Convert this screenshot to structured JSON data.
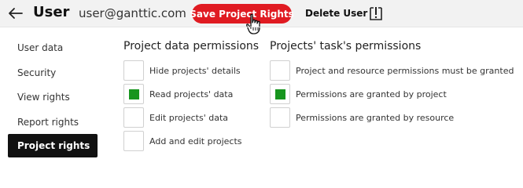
{
  "header": {
    "title": "User",
    "email": "user@ganttic.com",
    "save_label": "Save Project Rights",
    "delete_label": "Delete User"
  },
  "sidebar": {
    "items": [
      {
        "label": "User data",
        "active": false
      },
      {
        "label": "Security",
        "active": false
      },
      {
        "label": "View rights",
        "active": false
      },
      {
        "label": "Report rights",
        "active": false
      },
      {
        "label": "Project rights",
        "active": true
      }
    ]
  },
  "project_data_permissions": {
    "title": "Project data permissions",
    "options": [
      {
        "label": "Hide projects' details",
        "checked": false
      },
      {
        "label": "Read projects' data",
        "checked": true
      },
      {
        "label": "Edit projects' data",
        "checked": false
      },
      {
        "label": "Add and edit projects",
        "checked": false
      }
    ]
  },
  "task_permissions": {
    "title": "Projects' task's permissions",
    "options": [
      {
        "label": "Project and resource permissions must be granted",
        "checked": false
      },
      {
        "label": "Permissions are granted by project",
        "checked": true
      },
      {
        "label": "Permissions are granted by resource",
        "checked": false
      }
    ]
  },
  "colors": {
    "accent": "#e01b22",
    "checked": "#17951e",
    "active_nav": "#111111"
  },
  "icons": {
    "back": "arrow-left-icon",
    "info": "document-info-icon",
    "cursor": "hand-pointer-icon"
  }
}
